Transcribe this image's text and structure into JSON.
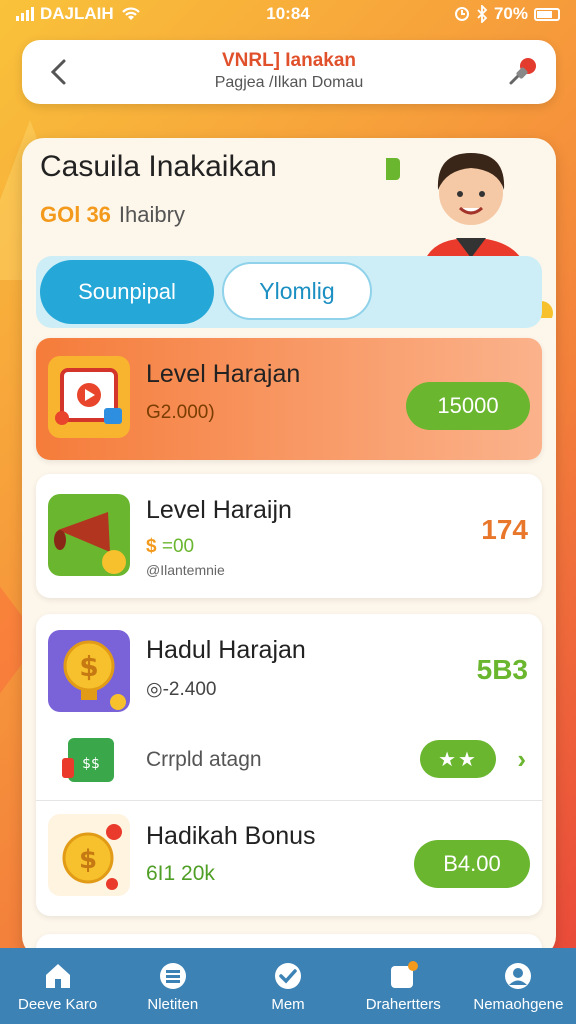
{
  "status_bar": {
    "carrier": "DAJLAIH",
    "time": "10:84",
    "battery": "70%"
  },
  "header": {
    "title": "VNRL] Ianakan",
    "subtitle": "Pagjea /Ilkan Domau"
  },
  "panel": {
    "title": "Casuila Inakaikan",
    "count": "GOl 36",
    "count_label": "Ihaibry"
  },
  "tabs": [
    {
      "label": "Sounpipal"
    },
    {
      "label": "Ylomlig"
    }
  ],
  "items": [
    {
      "title": "Level Harajan",
      "sub": "G2.000)",
      "button": "15000"
    },
    {
      "title": "Level Haraijn",
      "sub": "=00",
      "sub2": "@Ilantemnie",
      "value": "174"
    },
    {
      "title": "Hadul Harajan",
      "sub": "-2.400",
      "value": "5B3"
    },
    {
      "title": "Crrpld atagn"
    },
    {
      "title": "Hadikah Bonus",
      "sub": "6I1 20k",
      "button": "B4.00"
    }
  ],
  "nav": [
    {
      "label": "Deeve Karo",
      "icon": "home-icon"
    },
    {
      "label": "Nletiten",
      "icon": "list-icon"
    },
    {
      "label": "Mem",
      "icon": "check-icon"
    },
    {
      "label": "Drahertters",
      "icon": "notification-icon"
    },
    {
      "label": "Nemaohgene",
      "icon": "profile-icon"
    }
  ],
  "colors": {
    "accent_blue": "#25a7d8",
    "green": "#6ab62f",
    "orange": "#f39a1c",
    "nav_bg": "#3c82b4"
  }
}
